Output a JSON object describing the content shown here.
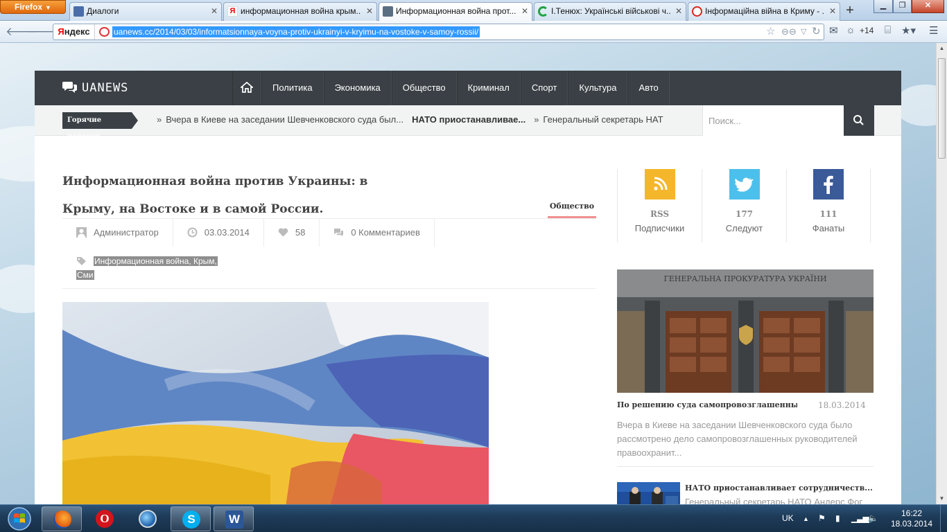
{
  "browser": {
    "firefox_button": "Firefox",
    "tabs": [
      {
        "label": "Диалоги",
        "favicon_color": "#4a6da7"
      },
      {
        "label": "информационная война крым...",
        "favicon_color": "#e8412d"
      },
      {
        "label": "Информационная война прот...",
        "favicon_color": "#5a6f82"
      },
      {
        "label": "І.Тенюх: Українські військові ч...",
        "favicon_color": "#25a244"
      },
      {
        "label": "Інформаційна війна в Криму - ...",
        "favicon_color": "#d8261b"
      }
    ],
    "new_tab": "+",
    "search_engine": {
      "first": "Я",
      "rest": "ндекс"
    },
    "url": "uanews.cc/2014/03/03/informatsionnaya-voyna-protiv-ukrainyi-v-kryimu-na-vostoke-v-samoy-rossii/",
    "weather": "+14"
  },
  "site": {
    "logo": "UANEWS",
    "menu": [
      "Политика",
      "Экономика",
      "Общество",
      "Криминал",
      "Спорт",
      "Культура",
      "Авто"
    ],
    "ticker_label": "Горячие новости",
    "ticker_items": [
      {
        "text": "Вчера в Киеве на заседании Шевченковского суда был...",
        "bold": false
      },
      {
        "text": "НАТО приостанавливае...",
        "bold": true
      },
      {
        "text": "Генеральный секретарь НАТ",
        "bold": false
      }
    ],
    "search_placeholder": "Поиск..."
  },
  "article": {
    "title": "Информационная война против Украины: в Крыму, на Востоке и в самой России.",
    "category": "Общество",
    "author": "Администратор",
    "date": "03.03.2014",
    "likes": "58",
    "comments": "0 Комментариев",
    "tags_line1": "Информационная война, Крым,",
    "tags_line2": "Сми"
  },
  "sidebar": {
    "social": [
      {
        "count": "RSS",
        "label": "Подписчики",
        "color": "#f4b62a"
      },
      {
        "count": "177",
        "label": "Следуют",
        "color": "#4cc0ec"
      },
      {
        "count": "111",
        "label": "Фанаты",
        "color": "#3a5a98"
      }
    ],
    "feature": {
      "sign": "ГЕНЕРАЛЬНА ПРОКУРАТУРА УКРАЇНИ",
      "title": "По решению суда самопровозглашенных...",
      "date": "18.03.2014",
      "excerpt": "Вчера в Киеве на заседании Шевченковского суда было рассмотрено дело самопровозглашенных руководителей правоохранит..."
    },
    "small": {
      "title": "НАТО приостанавливает сотрудничеств...",
      "excerpt": "Генеральный секретарь НАТО Андерс Фог"
    }
  },
  "taskbar": {
    "language": "UK",
    "time": "16:22",
    "date": "18.03.2014",
    "apps": [
      "firefox",
      "opera",
      "google-earth",
      "skype",
      "word"
    ]
  }
}
